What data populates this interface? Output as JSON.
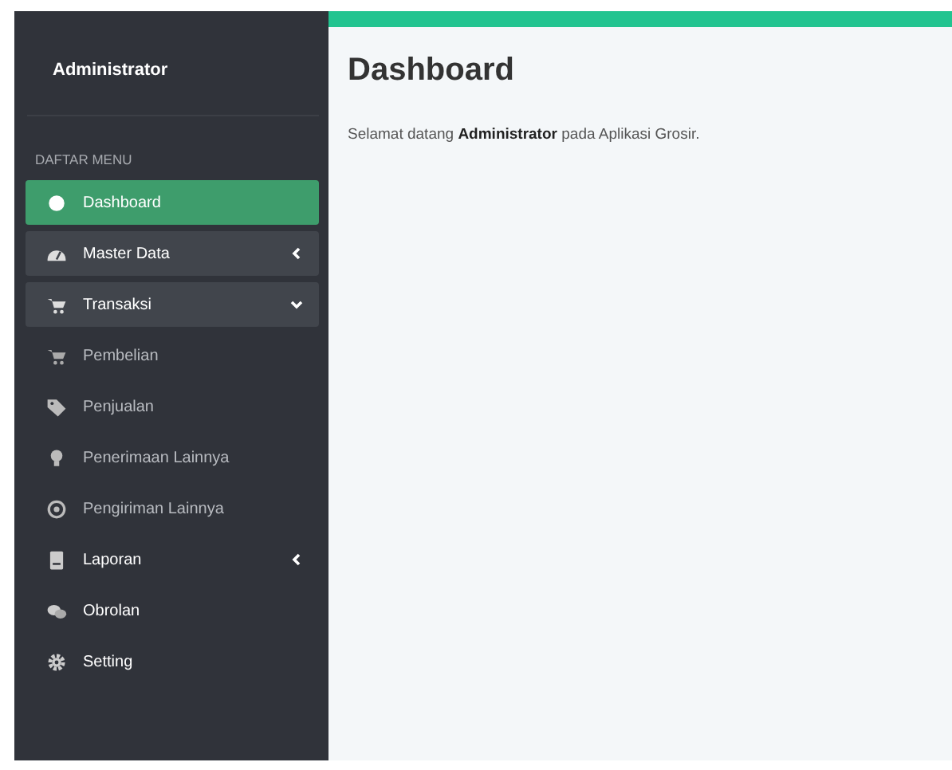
{
  "sidebar": {
    "user": "Administrator",
    "menu_header": "DAFTAR MENU",
    "items": [
      {
        "label": "Dashboard",
        "selected": true,
        "highlighted": false
      },
      {
        "label": "Master Data",
        "selected": false,
        "highlighted": true,
        "expanded": false
      },
      {
        "label": "Transaksi",
        "selected": false,
        "highlighted": true,
        "expanded": true,
        "children": [
          {
            "label": "Pembelian"
          },
          {
            "label": "Penjualan"
          },
          {
            "label": "Penerimaan Lainnya"
          },
          {
            "label": "Pengiriman Lainnya"
          }
        ]
      },
      {
        "label": "Laporan",
        "selected": false,
        "highlighted": false,
        "expanded": false
      },
      {
        "label": "Obrolan",
        "selected": false,
        "highlighted": false
      },
      {
        "label": "Setting",
        "selected": false,
        "highlighted": false
      }
    ]
  },
  "main": {
    "title": "Dashboard",
    "welcome": "Selamat datang **Administrator** pada Aplikasi Grosir."
  }
}
